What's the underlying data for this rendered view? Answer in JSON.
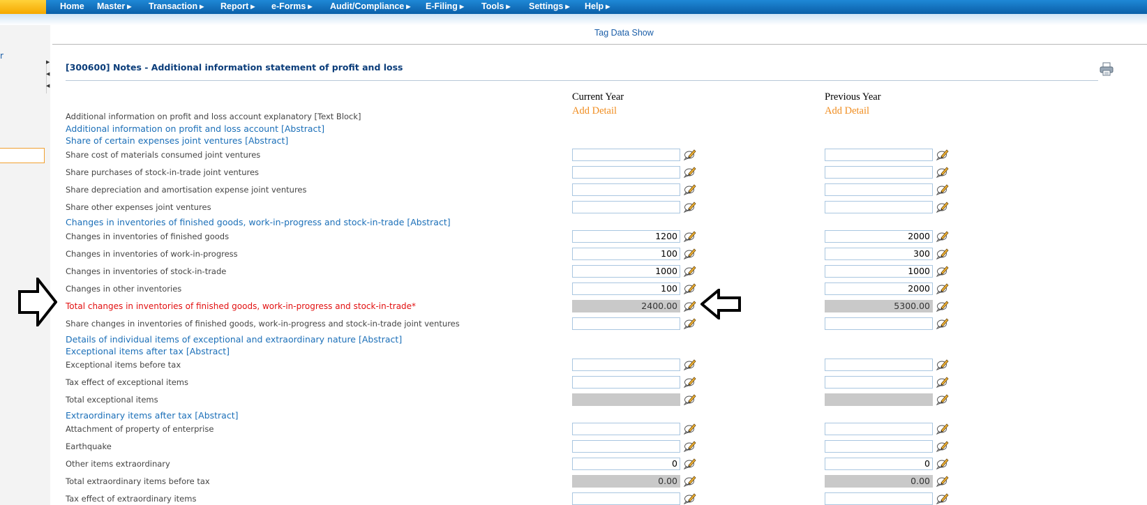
{
  "nav": {
    "items": [
      {
        "label": "Home",
        "has_submenu": false
      },
      {
        "label": "Master",
        "has_submenu": true
      },
      {
        "label": "Transaction",
        "has_submenu": true
      },
      {
        "label": "Report",
        "has_submenu": true
      },
      {
        "label": "e-Forms",
        "has_submenu": true
      },
      {
        "label": "Audit/Compliance",
        "has_submenu": true
      },
      {
        "label": "E-Filing",
        "has_submenu": true
      },
      {
        "label": "Tools",
        "has_submenu": true
      },
      {
        "label": "Settings",
        "has_submenu": true
      },
      {
        "label": "Help",
        "has_submenu": true
      }
    ],
    "submenu_glyph": "▶"
  },
  "sidebar": {
    "link_text": "r"
  },
  "header": {
    "tag_data_show": "Tag Data Show",
    "page_title": "[300600] Notes - Additional information statement of profit and loss"
  },
  "columns": {
    "current": {
      "title": "Current Year",
      "add_detail": "Add Detail"
    },
    "previous": {
      "title": "Previous Year",
      "add_detail": "Add Detail"
    }
  },
  "rows": [
    {
      "type": "label",
      "text": "Additional information on profit and loss account explanatory [Text Block]"
    },
    {
      "type": "abstract",
      "text": "Additional information on profit and loss account [Abstract]"
    },
    {
      "type": "abstract",
      "text": "Share of certain expenses joint ventures [Abstract]"
    },
    {
      "type": "input",
      "text": "Share cost of materials consumed joint ventures",
      "current": "",
      "previous": ""
    },
    {
      "type": "input",
      "text": "Share purchases of stock-in-trade joint ventures",
      "current": "",
      "previous": ""
    },
    {
      "type": "input",
      "text": "Share depreciation and amortisation expense joint ventures",
      "current": "",
      "previous": ""
    },
    {
      "type": "input",
      "text": "Share other expenses joint ventures",
      "current": "",
      "previous": ""
    },
    {
      "type": "abstract",
      "text": "Changes in inventories of finished goods, work-in-progress and stock-in-trade [Abstract]"
    },
    {
      "type": "input",
      "text": "Changes in inventories of finished goods",
      "current": "1200",
      "previous": "2000"
    },
    {
      "type": "input",
      "text": "Changes in inventories of work-in-progress",
      "current": "100",
      "previous": "300"
    },
    {
      "type": "input",
      "text": "Changes in inventories of stock-in-trade",
      "current": "1000",
      "previous": "1000"
    },
    {
      "type": "input",
      "text": "Changes in other inventories",
      "current": "100",
      "previous": "2000"
    },
    {
      "type": "total",
      "text": "Total changes in inventories of finished goods, work-in-progress and stock-in-trade*",
      "current": "2400.00",
      "previous": "5300.00"
    },
    {
      "type": "input",
      "text": "Share changes in inventories of finished goods, work-in-progress and stock-in-trade joint ventures",
      "current": "",
      "previous": ""
    },
    {
      "type": "abstract",
      "text": "Details of individual items of exceptional and extraordinary nature [Abstract]"
    },
    {
      "type": "abstract",
      "text": "Exceptional items after tax [Abstract]"
    },
    {
      "type": "input",
      "text": "Exceptional items before tax",
      "current": "",
      "previous": ""
    },
    {
      "type": "input",
      "text": "Tax effect of exceptional items",
      "current": "",
      "previous": ""
    },
    {
      "type": "readonly",
      "text": "Total exceptional items",
      "current": "",
      "previous": ""
    },
    {
      "type": "abstract",
      "text": "Extraordinary items after tax [Abstract]"
    },
    {
      "type": "input",
      "text": "Attachment of property of enterprise",
      "current": "",
      "previous": ""
    },
    {
      "type": "input",
      "text": "Earthquake",
      "current": "",
      "previous": ""
    },
    {
      "type": "input",
      "text": "Other items extraordinary",
      "current": "0",
      "previous": "0"
    },
    {
      "type": "readonly",
      "text": "Total extraordinary items before tax",
      "current": "0.00",
      "previous": "0.00"
    },
    {
      "type": "input",
      "text": "Tax effect of extraordinary items",
      "current": "",
      "previous": ""
    }
  ]
}
